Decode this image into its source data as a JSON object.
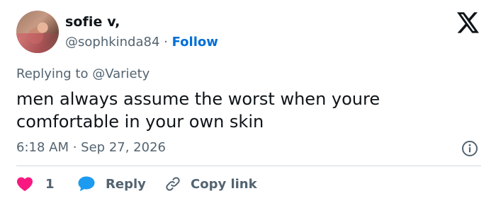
{
  "author": {
    "name": "sofie v,",
    "handle": "@sophkinda84",
    "separator": " · ",
    "follow_label": "Follow"
  },
  "reply_context": {
    "prefix": "Replying to ",
    "mention": "@Variety"
  },
  "tweet": {
    "text": "men always assume the worst when youre comfortable in your own skin",
    "time": "6:18 AM",
    "separator": " · ",
    "date": "Sep 27, 2026"
  },
  "actions": {
    "like_count": "1",
    "reply_label": "Reply",
    "copy_label": "Copy link"
  },
  "colors": {
    "text": "#0f1419",
    "secondary": "#536471",
    "link": "#006fd6",
    "like": "#f91880",
    "reply": "#1d9bf0",
    "divider": "#cfd9de"
  },
  "icons": {
    "brand": "x-logo-icon",
    "info": "info-icon",
    "like": "heart-icon",
    "reply": "speech-bubble-icon",
    "copy": "link-icon"
  }
}
